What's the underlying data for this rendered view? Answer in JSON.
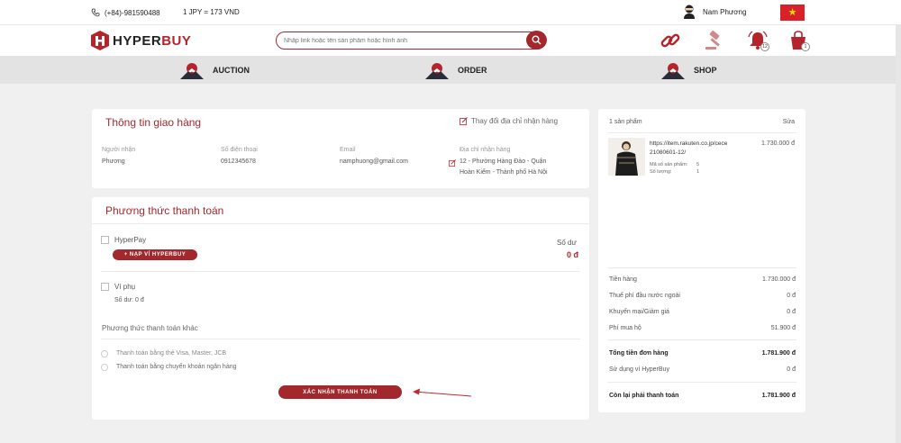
{
  "topbar": {
    "phone": "(+84)-981590488",
    "exchange_rate": "1 JPY = 173 VND",
    "user_name": "Nam Phương",
    "flag": "★"
  },
  "header": {
    "logo_part1": "HYPER",
    "logo_part2": "BUY",
    "search_placeholder": "Nhập link hoặc tên sản phẩm hoặc hình ảnh",
    "notification_count": "12",
    "cart_count": "1"
  },
  "nav": {
    "items": [
      {
        "label": "AUCTION"
      },
      {
        "label": "ORDER"
      },
      {
        "label": "SHOP"
      }
    ]
  },
  "shipping": {
    "title": "Thông tin giao hàng",
    "change_address": "Thay đổi địa chỉ nhận hàng",
    "recipient_label": "Người nhận",
    "recipient": "Phương",
    "phone_label": "Số điện thoại",
    "phone": "0912345678",
    "email_label": "Email",
    "email": "namphuong@gmail.com",
    "address_label": "Địa chỉ nhận hàng",
    "address_line1": "12 - Phường Hàng Đào - Quận",
    "address_line2": "Hoàn Kiếm - Thành phố Hà Nội"
  },
  "payment": {
    "title": "Phương thức thanh toán",
    "hyperpay_label": "HyperPay",
    "topup_button": "+ NẠP VÍ HYPERBUY",
    "balance_label": "Số dư",
    "balance_value": "0 đ",
    "sub_wallet_label": "Ví phụ",
    "sub_wallet_balance": "Số dư: 0 đ",
    "other_methods_title": "Phương thức thanh toán khác",
    "method_card": "Thanh toán bằng thẻ Visa, Master, JCB",
    "method_transfer": "Thanh toán bằng chuyển khoản ngân hàng",
    "confirm_button": "XÁC NHẬN THANH TOÁN"
  },
  "summary": {
    "product_count": "1 sản phẩm",
    "edit": "Sửa",
    "product": {
      "link_line1": "https://item.rakuten.co.jp/cece",
      "link_line2": "21080601-12/",
      "price": "1.730.000 đ",
      "item_count_label": "Mã số sản phẩm:",
      "item_count_value": "5",
      "quantity_label": "Số lượng:",
      "quantity_value": "1"
    },
    "rows": [
      {
        "label": "Tiền hàng",
        "value": "1.730.000 đ"
      },
      {
        "label": "Thuế phí đầu nước ngoài",
        "value": "0 đ"
      },
      {
        "label": "Khuyến mại/Giảm giá",
        "value": "0 đ"
      },
      {
        "label": "Phí mua hộ",
        "value": "51.900 đ"
      }
    ],
    "total_label": "Tổng tiền đơn hàng",
    "total_value": "1.781.900 đ",
    "wallet_label": "Sử dụng ví HyperBuy",
    "wallet_value": "0 đ",
    "remaining_label": "Còn lại phải thanh toán",
    "remaining_value": "1.781.900 đ"
  },
  "colors": {
    "brand": "#a3282e",
    "nav_bg": "#e3e3e3",
    "page_bg": "#f0f0f0"
  }
}
